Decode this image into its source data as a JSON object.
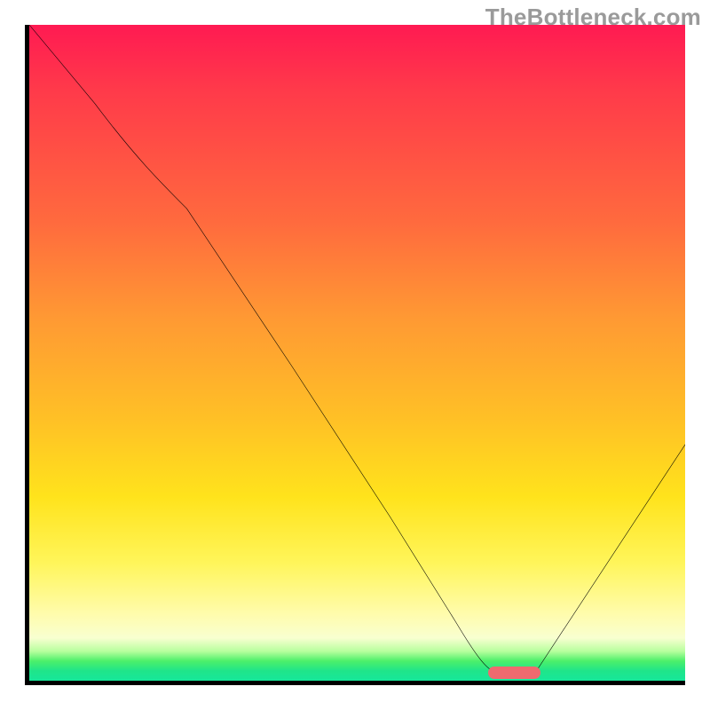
{
  "watermark": "TheBottleneck.com",
  "chart_data": {
    "type": "line",
    "title": "",
    "xlabel": "",
    "ylabel": "",
    "xlim": [
      0,
      100
    ],
    "ylim": [
      0,
      100
    ],
    "grid": false,
    "series": [
      {
        "name": "bottleneck-curve",
        "x": [
          0,
          10,
          24,
          40,
          55,
          65,
          72,
          77,
          100
        ],
        "y": [
          100,
          88,
          72,
          48,
          25,
          9,
          1,
          1,
          36
        ]
      }
    ],
    "marker": {
      "name": "optimal-range",
      "x_start": 70,
      "x_end": 78,
      "y": 0.9
    },
    "colors": {
      "curve": "#000000",
      "marker": "#ef6a6f",
      "gradient_top": "#ff1a52",
      "gradient_mid": "#ffcf20",
      "gradient_bottom": "#16e79a"
    }
  }
}
